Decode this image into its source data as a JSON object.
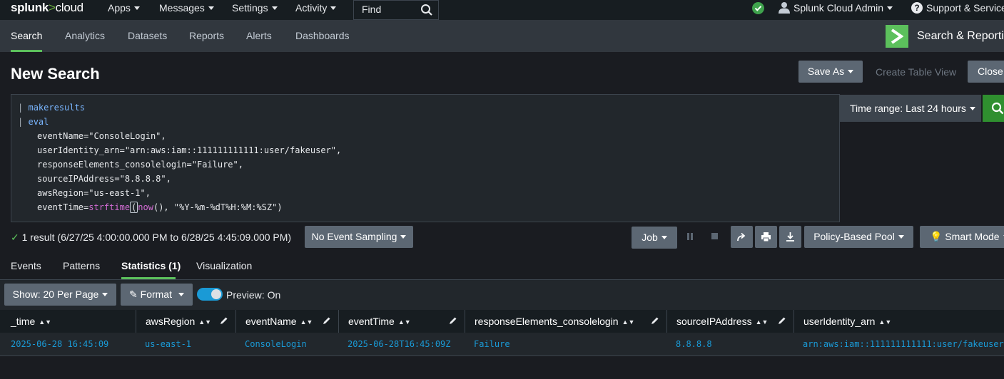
{
  "topbar": {
    "logo_main": "splunk",
    "logo_gt": ">",
    "logo_suffix": "cloud",
    "menus": [
      "Apps",
      "Messages",
      "Settings",
      "Activity"
    ],
    "find_label": "Find",
    "user_label": "Splunk Cloud Admin",
    "help_label": "Support & Services"
  },
  "appbar": {
    "tabs": [
      "Search",
      "Analytics",
      "Datasets",
      "Reports",
      "Alerts",
      "Dashboards"
    ],
    "active_tab": "Search",
    "app_title": "Search & Reporting"
  },
  "page": {
    "title": "New Search",
    "save_as": "Save As",
    "create_table_view": "Create Table View",
    "close": "Close"
  },
  "query": {
    "lines": [
      "makeresults",
      "eval",
      "eventName=\"ConsoleLogin\",",
      "userIdentity_arn=\"arn:aws:iam::111111111111:user/fakeuser\",",
      "responseElements_consolelogin=\"Failure\",",
      "sourceIPAddress=\"8.8.8.8\",",
      "awsRegion=\"us-east-1\",",
      "eventTime=",
      "strftime",
      "(",
      "now",
      "(), \"%Y-%m-%dT%H:%M:%SZ\")"
    ],
    "pipe": "|"
  },
  "time_range": "Time range: Last 24 hours",
  "status": {
    "result_text": "1 result (6/27/25 4:00:00.000 PM to 6/28/25 4:45:09.000 PM)",
    "sampling": "No Event Sampling",
    "job": "Job",
    "pool": "Policy-Based Pool",
    "mode": "Smart Mode"
  },
  "result_tabs": {
    "tabs": [
      "Events",
      "Patterns",
      "Statistics (1)",
      "Visualization"
    ],
    "active": "Statistics (1)"
  },
  "toolbar": {
    "show": "Show: 20 Per Page",
    "format": "Format",
    "preview": "Preview: On"
  },
  "table": {
    "columns": [
      "_time",
      "awsRegion",
      "eventName",
      "eventTime",
      "responseElements_consolelogin",
      "sourceIPAddress",
      "userIdentity_arn"
    ],
    "rows": [
      [
        "2025-06-28 16:45:09",
        "us-east-1",
        "ConsoleLogin",
        "2025-06-28T16:45:09Z",
        "Failure",
        "8.8.8.8",
        "arn:aws:iam::111111111111:user/fakeuser"
      ]
    ]
  },
  "colors": {
    "accent_green": "#5cc05c",
    "link_blue": "#1a9ad6",
    "keyword_blue": "#7ab6ff",
    "function_magenta": "#d46cd5"
  }
}
